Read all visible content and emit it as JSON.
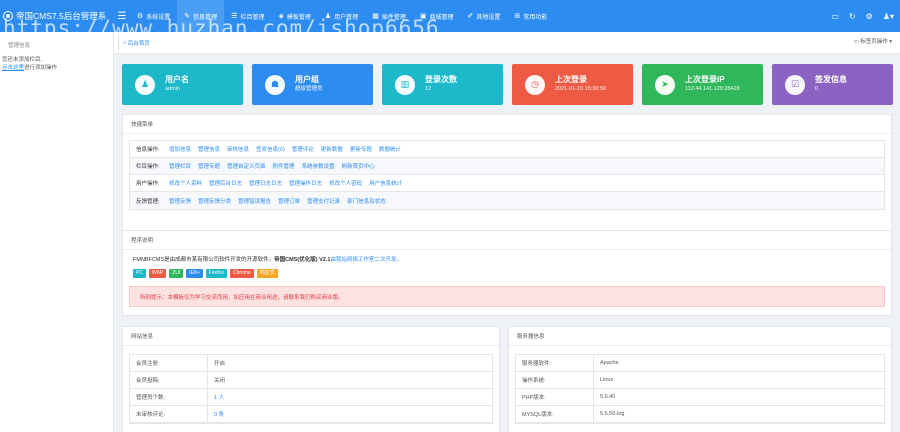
{
  "brand": {
    "title": "帝国CMS7.5后台管理系"
  },
  "nav": [
    {
      "label": "系统设置",
      "icon": "gear-icon",
      "glyph": "⚙"
    },
    {
      "label": "信息管理",
      "icon": "edit-icon",
      "glyph": "✎"
    },
    {
      "label": "栏目管理",
      "icon": "list-icon",
      "glyph": "☰"
    },
    {
      "label": "模板管理",
      "icon": "layers-icon",
      "glyph": "◈"
    },
    {
      "label": "用户管理",
      "icon": "user-icon",
      "glyph": "♟"
    },
    {
      "label": "插件管理",
      "icon": "plugin-icon",
      "glyph": "▦"
    },
    {
      "label": "商城管理",
      "icon": "shop-icon",
      "glyph": "▣"
    },
    {
      "label": "其他设置",
      "icon": "wrench-icon",
      "glyph": "✐"
    },
    {
      "label": "常用功能",
      "icon": "grid-icon",
      "glyph": "⊞"
    }
  ],
  "watermark": "https://www.huzhan.com/ishop6656",
  "sidebar": {
    "title": "管理信息",
    "msg_line1": "您还未添加栏目,",
    "msg_link": "点击这里",
    "msg_line2": "进行添加操作"
  },
  "tabbar": {
    "tab_label": "后台首页",
    "ops_label": "标签页操作"
  },
  "cards": [
    {
      "title": "用户名",
      "sub": "admin",
      "color": "#1db8c9",
      "icon": "user-icon",
      "glyph": "♟"
    },
    {
      "title": "用户组",
      "sub": "超级管理员",
      "color": "#2d8cf0",
      "icon": "users-icon",
      "glyph": "☗"
    },
    {
      "title": "登录次数",
      "sub": "12",
      "color": "#1db8c9",
      "icon": "chart-icon",
      "glyph": "▥"
    },
    {
      "title": "上次登录",
      "sub": "2021-01-15 15:30:50",
      "color": "#ef5a44",
      "icon": "clock-icon",
      "glyph": "◷"
    },
    {
      "title": "上次登录IP",
      "sub": "112.44.141.129:28428",
      "color": "#30b75b",
      "icon": "navigation-icon",
      "glyph": "➤"
    },
    {
      "title": "签发信息",
      "sub": "0",
      "color": "#8c63c3",
      "icon": "check-square-icon",
      "glyph": "☑"
    }
  ],
  "quick": {
    "title": "快捷菜单",
    "rows": [
      {
        "label": "信息操作:",
        "links": [
          "增加信息",
          "管理信息",
          "审核信息",
          "签发信息(0)",
          "管理评论",
          "更新数据",
          "更新专题",
          "数据统计"
        ]
      },
      {
        "label": "栏目操作:",
        "links": [
          "管理栏目",
          "管理专题",
          "管理自定义页面",
          "附件管理",
          "系统参数设置",
          "刷新首页中心"
        ]
      },
      {
        "label": "用户操作:",
        "links": [
          "修改个人资料",
          "管理后台日志",
          "管理日志日志",
          "管理操作日志",
          "修改个人密码",
          "用户信息统计"
        ]
      },
      {
        "label": "反馈管理:",
        "links": [
          "管理反馈",
          "管理反馈分类",
          "管理错误报告",
          "管理订单",
          "管理支付记录",
          "部门信息及状态"
        ]
      }
    ]
  },
  "intro": {
    "title": "程序说明",
    "line_prefix": "FMNBFCMS是由成都市某有限公司软件开发的开源软件。",
    "line_name": "帝国CMS(优化版) V2.1",
    "line_suffix": "由我站网络工作室二次开发。",
    "tags": [
      {
        "label": "PC",
        "color": "#1db8c9"
      },
      {
        "label": "WAP",
        "color": "#ef5a44"
      },
      {
        "label": "ZUI",
        "color": "#30b75b"
      },
      {
        "label": "IE8+",
        "color": "#2d8cf0"
      },
      {
        "label": "Firefox",
        "color": "#1db8c9"
      },
      {
        "label": "Chrome",
        "color": "#ef5a44"
      },
      {
        "label": "响应式",
        "color": "#f5a623"
      }
    ],
    "alert": "特别提示：本模板仅为学习交流而用，如应用在商业用途，请联系我们购买商业版。"
  },
  "website": {
    "title": "网站信息",
    "rows": [
      {
        "k": "会员注册:",
        "v": "开启",
        "blue": false
      },
      {
        "k": "会员投稿:",
        "v": "关闭",
        "blue": false
      },
      {
        "k": "管理员个数:",
        "v": "1 人",
        "blue": true
      },
      {
        "k": "未审核评论:",
        "v": "0 条",
        "blue": true
      }
    ]
  },
  "server": {
    "title": "服务器信息",
    "rows": [
      {
        "k": "服务器软件:",
        "v": "Apache"
      },
      {
        "k": "操作系统:",
        "v": "Linux"
      },
      {
        "k": "PHP版本:",
        "v": "5.6.40"
      },
      {
        "k": "MYSQL版本:",
        "v": "5.6.50-log"
      }
    ]
  }
}
